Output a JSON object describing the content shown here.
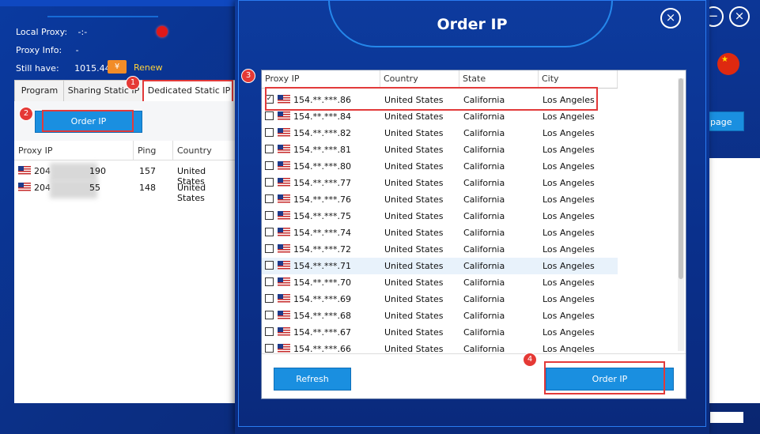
{
  "left": {
    "local_proxy_label": "Local Proxy:",
    "local_proxy_value": "-:-",
    "proxy_info_label": "Proxy Info:",
    "proxy_info_value": "-",
    "still_have_label": "Still have:",
    "still_have_value": "1015.44",
    "renew_label": "Renew",
    "tabs": [
      "Program",
      "Sharing Static IP",
      "Dedicated Static IP"
    ],
    "order_ip_button": "Order IP",
    "columns": [
      "Proxy IP",
      "Ping",
      "Country"
    ],
    "rows": [
      {
        "ip_start": "204",
        "ip_end": "190",
        "ping": "157",
        "country": "United States"
      },
      {
        "ip_start": "204",
        "ip_end": "55",
        "ping": "148",
        "country": "United States"
      }
    ],
    "right_button_partial": "page"
  },
  "badges": [
    "1",
    "2",
    "3",
    "4"
  ],
  "modal": {
    "title": "Order IP",
    "close_icon": "close-icon",
    "columns": [
      "Proxy IP",
      "Country",
      "State",
      "City"
    ],
    "rows": [
      {
        "ip": "154.**.***.86",
        "country": "United States",
        "state": "California",
        "city": "Los Angeles",
        "checked": true
      },
      {
        "ip": "154.**.***.84",
        "country": "United States",
        "state": "California",
        "city": "Los Angeles",
        "checked": false
      },
      {
        "ip": "154.**.***.82",
        "country": "United States",
        "state": "California",
        "city": "Los Angeles",
        "checked": false
      },
      {
        "ip": "154.**.***.81",
        "country": "United States",
        "state": "California",
        "city": "Los Angeles",
        "checked": false
      },
      {
        "ip": "154.**.***.80",
        "country": "United States",
        "state": "California",
        "city": "Los Angeles",
        "checked": false
      },
      {
        "ip": "154.**.***.77",
        "country": "United States",
        "state": "California",
        "city": "Los Angeles",
        "checked": false
      },
      {
        "ip": "154.**.***.76",
        "country": "United States",
        "state": "California",
        "city": "Los Angeles",
        "checked": false
      },
      {
        "ip": "154.**.***.75",
        "country": "United States",
        "state": "California",
        "city": "Los Angeles",
        "checked": false
      },
      {
        "ip": "154.**.***.74",
        "country": "United States",
        "state": "California",
        "city": "Los Angeles",
        "checked": false
      },
      {
        "ip": "154.**.***.72",
        "country": "United States",
        "state": "California",
        "city": "Los Angeles",
        "checked": false
      },
      {
        "ip": "154.**.***.71",
        "country": "United States",
        "state": "California",
        "city": "Los Angeles",
        "checked": false
      },
      {
        "ip": "154.**.***.70",
        "country": "United States",
        "state": "California",
        "city": "Los Angeles",
        "checked": false
      },
      {
        "ip": "154.**.***.69",
        "country": "United States",
        "state": "California",
        "city": "Los Angeles",
        "checked": false
      },
      {
        "ip": "154.**.***.68",
        "country": "United States",
        "state": "California",
        "city": "Los Angeles",
        "checked": false
      },
      {
        "ip": "154.**.***.67",
        "country": "United States",
        "state": "California",
        "city": "Los Angeles",
        "checked": false
      },
      {
        "ip": "154.**.***.66",
        "country": "United States",
        "state": "California",
        "city": "Los Angeles",
        "checked": false
      }
    ],
    "refresh_button": "Refresh",
    "order_ip_button": "Order IP"
  },
  "colors": {
    "accent": "#1a8fe0",
    "highlight": "#e23a3a",
    "status_dot": "#e01818"
  }
}
